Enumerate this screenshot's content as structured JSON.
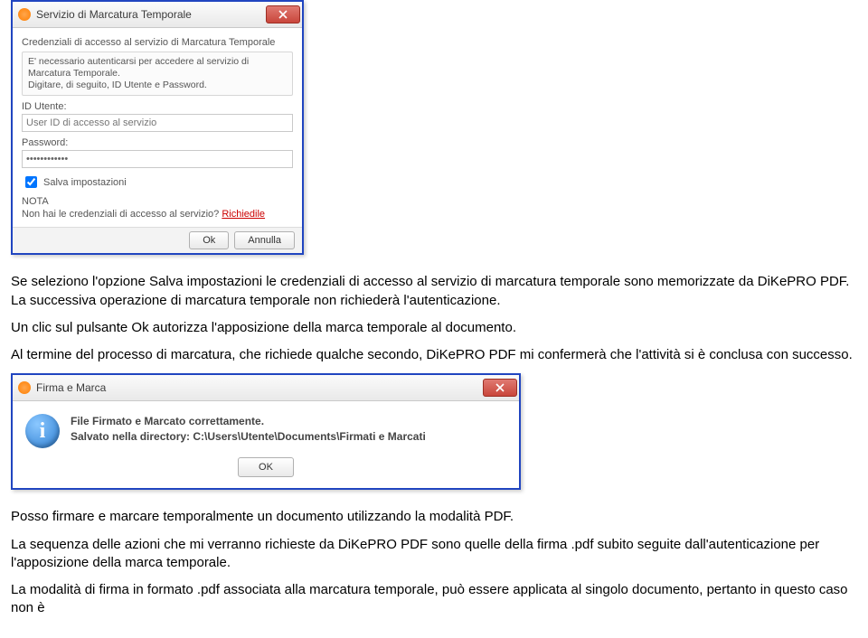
{
  "dialog1": {
    "title": "Servizio di Marcatura Temporale",
    "section": "Credenziali di accesso al servizio di Marcatura Temporale",
    "info1": "E' necessario autenticarsi per accedere al servizio di Marcatura Temporale.",
    "info2": "Digitare, di seguito, ID Utente e Password.",
    "id_label": "ID Utente:",
    "id_placeholder": "User ID di accesso al servizio",
    "id_value": "",
    "pw_label": "Password:",
    "pw_value": "••••••••••••",
    "save_label": "Salva impostazioni",
    "nota_header": "NOTA",
    "nota_text": "Non hai le credenziali di accesso al servizio?",
    "nota_link": "Richiedile",
    "ok": "Ok",
    "cancel": "Annulla"
  },
  "para1": "Se seleziono l'opzione Salva impostazioni le credenziali di accesso al servizio di marcatura temporale sono memorizzate da DiKePRO PDF. La successiva operazione di marcatura temporale non richiederà l'autenticazione.",
  "para2": "Un clic sul pulsante Ok autorizza l'apposizione della marca temporale al documento.",
  "para3": "Al termine del processo di marcatura, che richiede qualche secondo, DiKePRO PDF mi confermerà che l'attività si è conclusa con successo.",
  "dialog2": {
    "title": "Firma e Marca",
    "line1": "File Firmato e Marcato correttamente.",
    "line2_prefix": "Salvato nella directory: ",
    "line2_path": "C:\\Users\\Utente\\Documents\\Firmati e Marcati",
    "ok": "OK"
  },
  "para4": "Posso firmare e marcare temporalmente un documento utilizzando la modalità PDF.",
  "para5": "La sequenza delle azioni che mi verranno richieste da DiKePRO PDF sono quelle della firma .pdf subito seguite dall'autenticazione per l'apposizione della marca temporale.",
  "para6": "La modalità di firma in formato .pdf associata alla marcatura temporale, può essere applicata al singolo documento, pertanto in questo caso non è"
}
